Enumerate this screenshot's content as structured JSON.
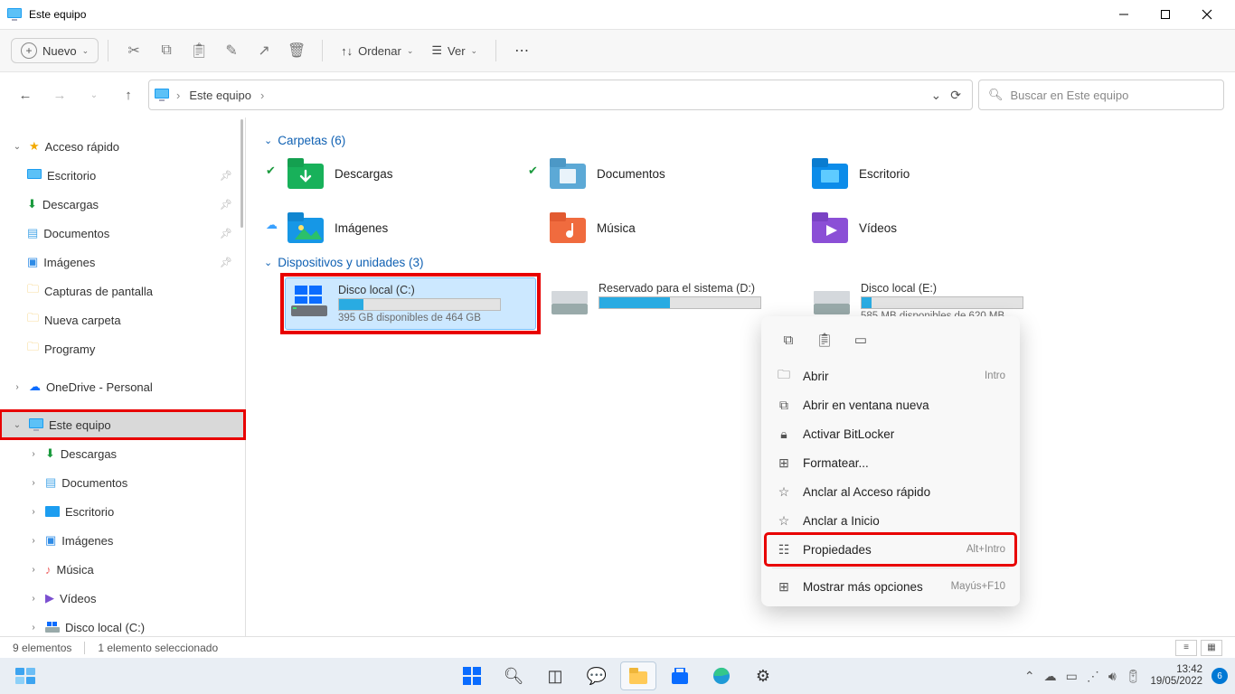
{
  "window": {
    "title": "Este equipo"
  },
  "commandbar": {
    "new": "Nuevo",
    "sort": "Ordenar",
    "view": "Ver"
  },
  "nav": {
    "breadcrumb_root": "Este equipo",
    "search_placeholder": "Buscar en Este equipo"
  },
  "sidebar": {
    "quick_access": "Acceso rápido",
    "desktop": "Escritorio",
    "downloads": "Descargas",
    "documents": "Documentos",
    "pictures": "Imágenes",
    "screenshots": "Capturas de pantalla",
    "new_folder": "Nueva carpeta",
    "programy": "Programy",
    "onedrive": "OneDrive - Personal",
    "this_pc": "Este equipo",
    "pc_downloads": "Descargas",
    "pc_documents": "Documentos",
    "pc_desktop": "Escritorio",
    "pc_pictures": "Imágenes",
    "pc_music": "Música",
    "pc_videos": "Vídeos",
    "pc_disk_c": "Disco local (C:)"
  },
  "content": {
    "folders_header": "Carpetas (6)",
    "drives_header": "Dispositivos y unidades (3)",
    "folders": {
      "downloads": "Descargas",
      "documents": "Documentos",
      "desktop": "Escritorio",
      "pictures": "Imágenes",
      "music": "Música",
      "videos": "Vídeos"
    },
    "drives": {
      "c_name": "Disco local (C:)",
      "c_avail": "395 GB disponibles de 464 GB",
      "c_fill_pct": 15,
      "d_name": "Reservado para el sistema (D:)",
      "d_fill_pct": 44,
      "e_name": "Disco local (E:)",
      "e_avail": "585 MB disponibles de 620 MB",
      "e_fill_pct": 6
    }
  },
  "context": {
    "open": "Abrir",
    "open_shortcut": "Intro",
    "open_new_window": "Abrir en ventana nueva",
    "bitlocker": "Activar BitLocker",
    "format": "Formatear...",
    "pin_quick": "Anclar al Acceso rápido",
    "pin_start": "Anclar a Inicio",
    "properties": "Propiedades",
    "properties_shortcut": "Alt+Intro",
    "more": "Mostrar más opciones",
    "more_shortcut": "Mayús+F10"
  },
  "status": {
    "count": "9 elementos",
    "selected": "1 elemento seleccionado"
  },
  "tray": {
    "time": "13:42",
    "date": "19/05/2022",
    "badge": "6"
  }
}
